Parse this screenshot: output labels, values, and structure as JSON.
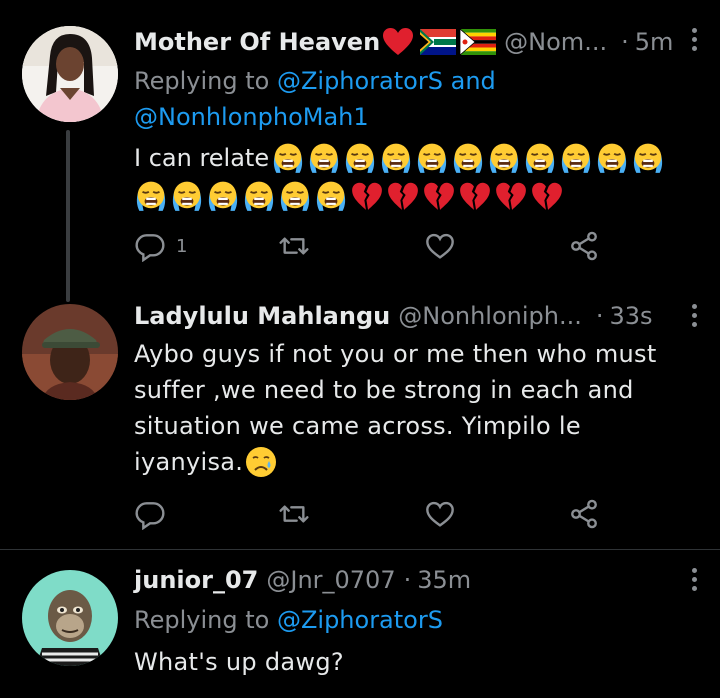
{
  "tweets": [
    {
      "name": "Mother Of Heaven",
      "handle": "@Nom...",
      "time": "5m",
      "replying_prefix": "Replying to",
      "replying_to_1": "@ZiphoratorS",
      "replying_and": "and",
      "replying_to_2": "@NonhlonphoMah1",
      "text": "I can relate",
      "reply_count": "1",
      "name_emojis": [
        "red-heart",
        "south-africa-flag",
        "zimbabwe-flag"
      ],
      "emojis_line1": [
        "loudly-crying-face",
        "loudly-crying-face",
        "loudly-crying-face",
        "loudly-crying-face",
        "loudly-crying-face",
        "loudly-crying-face",
        "loudly-crying-face",
        "loudly-crying-face",
        "loudly-crying-face",
        "loudly-crying-face",
        "loudly-crying-face"
      ],
      "emojis_line2": [
        "loudly-crying-face",
        "loudly-crying-face",
        "loudly-crying-face",
        "loudly-crying-face",
        "loudly-crying-face",
        "loudly-crying-face",
        "broken-heart",
        "broken-heart",
        "broken-heart",
        "broken-heart",
        "broken-heart",
        "broken-heart"
      ]
    },
    {
      "name": "Ladylulu Mahlangu",
      "handle": "@Nonhloniph...",
      "time": "33s",
      "text_lines": [
        "Aybo guys if not you or me then who must",
        "suffer ,we need to be strong in each and",
        "situation we came across. Yimpilo le",
        "iyanyisa."
      ],
      "trailing_emoji": "sad-but-relieved-face"
    },
    {
      "name": "junior_07",
      "handle": "@Jnr_0707",
      "time": "35m",
      "replying_prefix": "Replying to",
      "replying_to_1": "@ZiphoratorS",
      "text": "What's up dawg?"
    }
  ],
  "colors": {
    "background": "#000000",
    "text": "#e7e9ea",
    "secondary": "#8b8f94",
    "link": "#1d9bf0",
    "divider": "#2f3336"
  },
  "icons": [
    "reply-icon",
    "retweet-icon",
    "like-icon",
    "share-icon",
    "more-icon"
  ]
}
